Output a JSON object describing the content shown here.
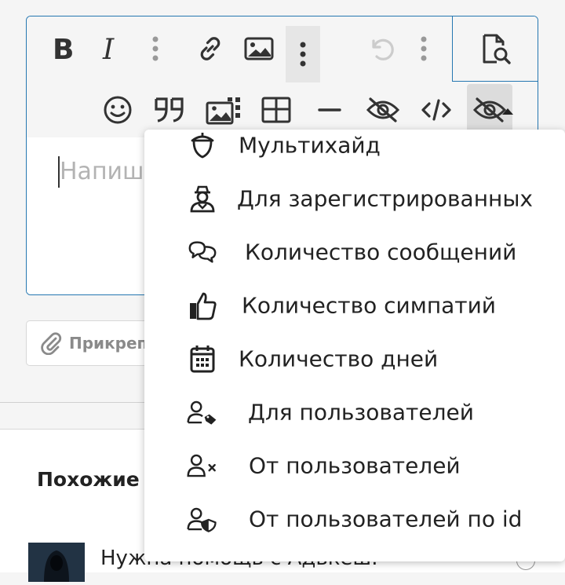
{
  "editor": {
    "placeholder": "Напиш",
    "toolbar_row1": [
      "bold-icon",
      "italic-icon",
      "more-vertical-icon",
      "link-icon",
      "image-icon",
      "more-vertical-icon",
      "undo-icon",
      "more-vertical-icon",
      "preview-icon"
    ],
    "toolbar_row2": [
      "smiley-icon",
      "quote-icon",
      "gallery-icon",
      "table-icon",
      "horizontal-rule-icon",
      "hide-icon",
      "code-icon",
      "hide-menu-icon"
    ]
  },
  "attach": {
    "label": "Прикреп"
  },
  "similar": {
    "title": "Похожие т"
  },
  "thread": {
    "title": "Нужна помощь с Адькеш."
  },
  "hide_menu": {
    "items": [
      {
        "icon": "acorn-icon",
        "label": "Мультихайд"
      },
      {
        "icon": "user-incognito-icon",
        "label": "Для зарегистрированных"
      },
      {
        "icon": "chat-bubbles-icon",
        "label": "Количество сообщений"
      },
      {
        "icon": "thumbs-up-icon",
        "label": "Количество симпатий"
      },
      {
        "icon": "calendar-icon",
        "label": "Количество дней"
      },
      {
        "icon": "user-tag-icon",
        "label": "Для пользователей"
      },
      {
        "icon": "user-times-icon",
        "label": "От пользователей"
      },
      {
        "icon": "user-shield-icon",
        "label": "От пользователей по id"
      }
    ]
  },
  "colors": {
    "accent": "#2577b1",
    "text": "#222222",
    "muted": "#b3b3b3"
  }
}
